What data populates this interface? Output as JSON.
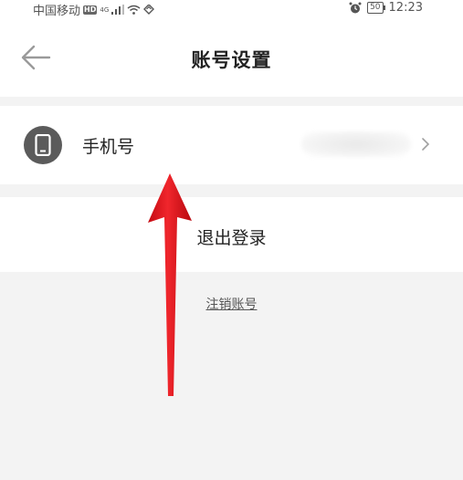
{
  "status_bar": {
    "carrier": "中国移动",
    "hd": "HD",
    "network": "4G",
    "battery": "50",
    "time": "12:23"
  },
  "header": {
    "title": "账号设置"
  },
  "settings": {
    "phone": {
      "label": "手机号",
      "value_state": "blurred"
    },
    "logout_label": "退出登录",
    "cancel_account_label": "注销账号"
  },
  "annotation": {
    "arrow_color": "#e8141c"
  },
  "colors": {
    "background": "#f3f3f3",
    "icon_circle": "#5b5b5b"
  }
}
